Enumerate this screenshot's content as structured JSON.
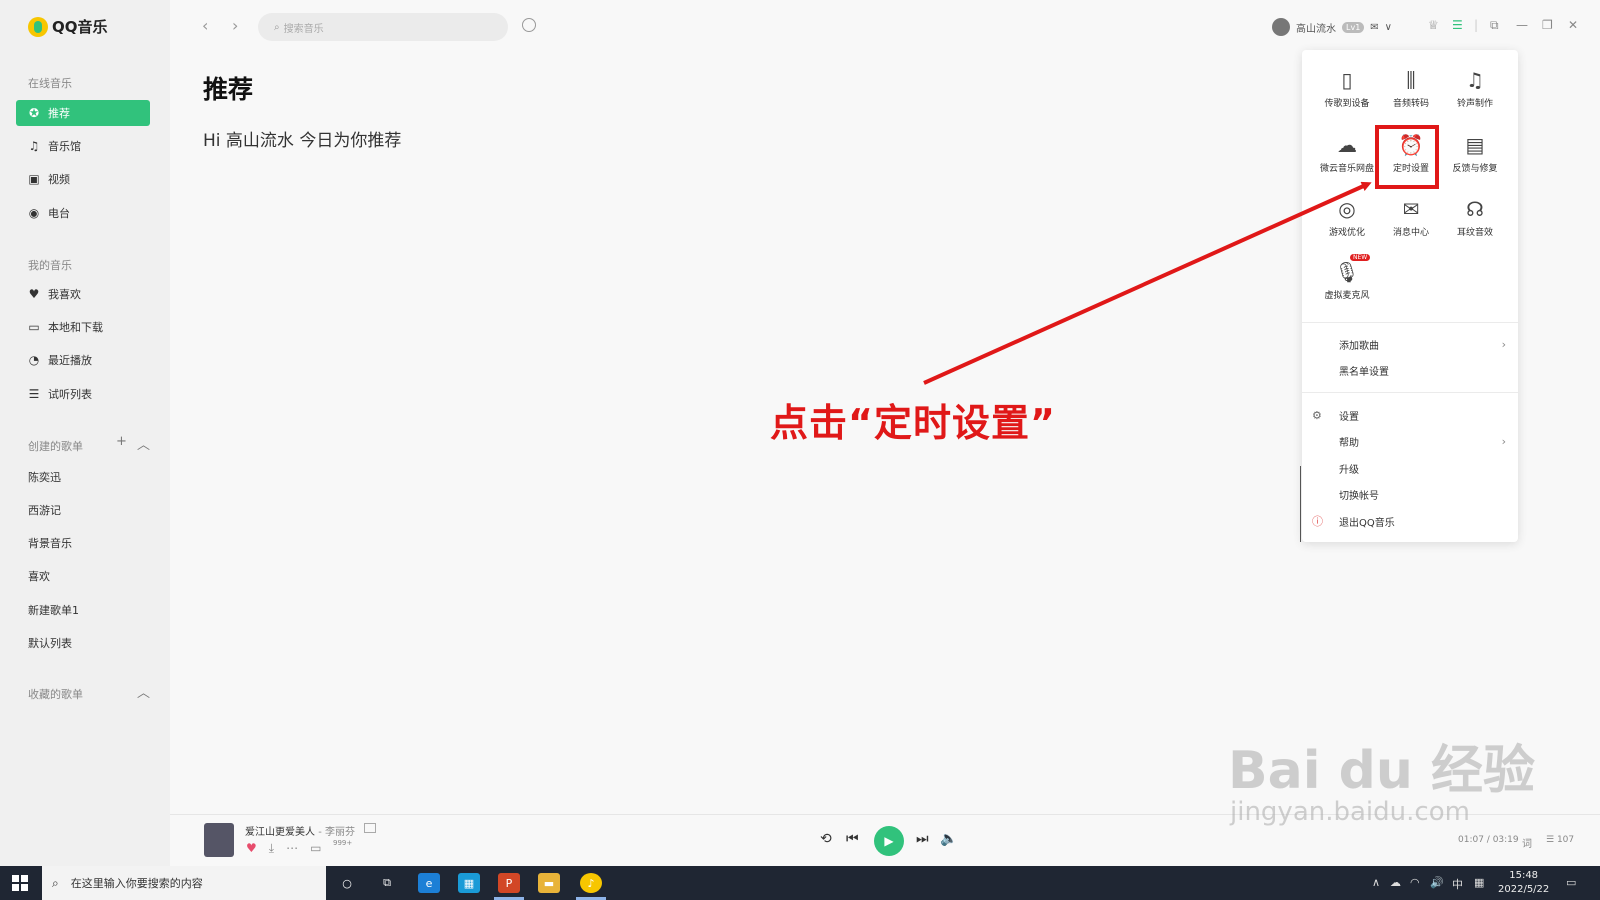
{
  "app": {
    "name": "QQ音乐"
  },
  "sidebar": {
    "online_title": "在线音乐",
    "online_items": [
      {
        "label": "推荐",
        "icon": "star-icon",
        "active": true
      },
      {
        "label": "音乐馆",
        "icon": "music-note-icon"
      },
      {
        "label": "视频",
        "icon": "video-icon"
      },
      {
        "label": "电台",
        "icon": "radio-icon"
      }
    ],
    "my_title": "我的音乐",
    "my_items": [
      {
        "label": "我喜欢",
        "icon": "heart-icon"
      },
      {
        "label": "本地和下载",
        "icon": "monitor-icon"
      },
      {
        "label": "最近播放",
        "icon": "clock-icon"
      },
      {
        "label": "试听列表",
        "icon": "list-icon"
      }
    ],
    "created_title": "创建的歌单",
    "playlists": [
      "陈奕迅",
      "西游记",
      "背景音乐",
      "喜欢",
      "新建歌单1",
      "默认列表"
    ],
    "collected_title": "收藏的歌单"
  },
  "topbar": {
    "search_placeholder": "搜索音乐",
    "username": "高山流水",
    "vip_badge": "Lv1"
  },
  "main": {
    "title": "推荐",
    "greeting": "Hi 高山流水 今日为你推荐"
  },
  "annotation": {
    "text": "点击“定时设置”",
    "color": "#e01818"
  },
  "popup": {
    "grid": [
      {
        "label": "传歌到设备",
        "icon": "phone-icon"
      },
      {
        "label": "音频转码",
        "icon": "waveform-icon"
      },
      {
        "label": "铃声制作",
        "icon": "bell-icon"
      },
      {
        "label": "微云音乐网盘",
        "icon": "cloud-icon"
      },
      {
        "label": "定时设置",
        "icon": "alarm-clock-icon"
      },
      {
        "label": "反馈与修复",
        "icon": "feedback-icon"
      },
      {
        "label": "游戏优化",
        "icon": "gamepad-icon"
      },
      {
        "label": "消息中心",
        "icon": "mail-icon"
      },
      {
        "label": "耳纹音效",
        "icon": "ear-icon"
      },
      {
        "label": "虚拟麦克风",
        "icon": "microphone-icon",
        "badge": "NEW"
      }
    ],
    "list1": [
      {
        "label": "添加歌曲",
        "arrow": true
      },
      {
        "label": "黑名单设置",
        "arrow": false
      }
    ],
    "list2": [
      {
        "label": "设置",
        "icon": "gear-icon",
        "arrow": false
      },
      {
        "label": "帮助",
        "arrow": true
      },
      {
        "label": "升级",
        "arrow": false
      },
      {
        "label": "切换帐号",
        "arrow": false
      },
      {
        "label": "退出QQ音乐",
        "icon": "exit-icon",
        "arrow": false
      }
    ]
  },
  "player": {
    "song": "爱江山更爱美人",
    "artist": "- 李丽芬",
    "comment_count": "999+",
    "time": "01:07 / 03:19",
    "lyrics_label": "词",
    "playlist_count": "107"
  },
  "watermark": {
    "main": "Bai du 经验",
    "url": "jingyan.baidu.com"
  },
  "taskbar": {
    "search_placeholder": "在这里输入你要搜索的内容",
    "time": "15:48",
    "date": "2022/5/22",
    "ime": "中"
  },
  "colors": {
    "accent": "#31c27c",
    "annotation_red": "#e01818"
  }
}
